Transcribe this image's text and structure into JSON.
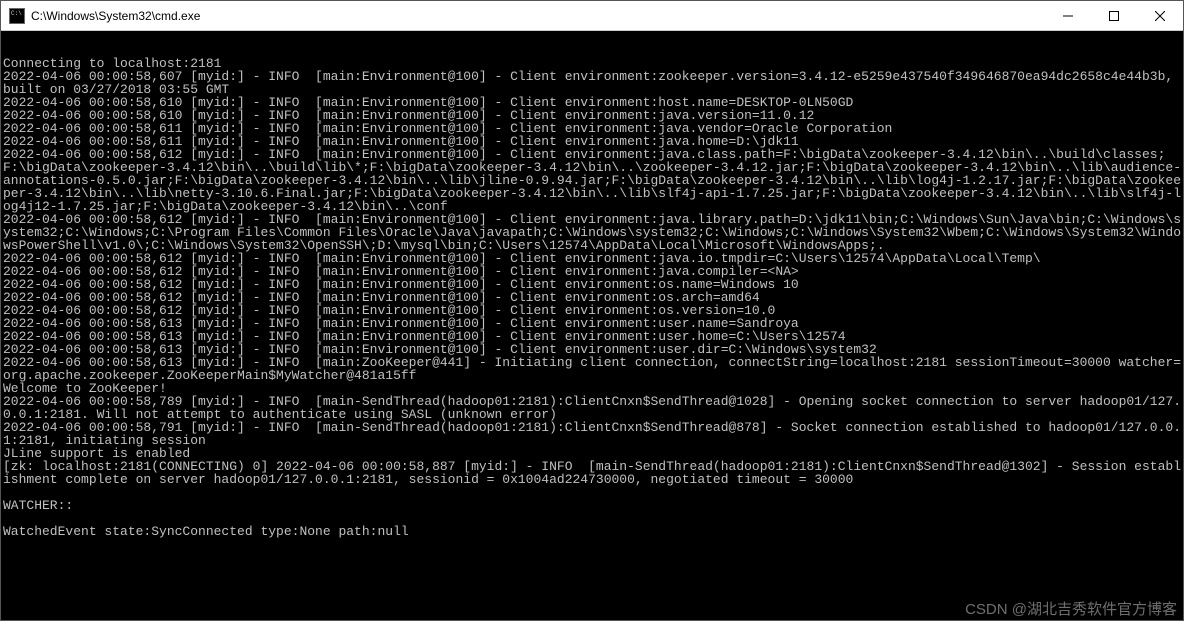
{
  "window": {
    "title": "C:\\Windows\\System32\\cmd.exe"
  },
  "terminal": {
    "lines": [
      "Connecting to localhost:2181",
      "2022-04-06 00:00:58,607 [myid:] - INFO  [main:Environment@100] - Client environment:zookeeper.version=3.4.12-e5259e437540f349646870ea94dc2658c4e44b3b, built on 03/27/2018 03:55 GMT",
      "2022-04-06 00:00:58,610 [myid:] - INFO  [main:Environment@100] - Client environment:host.name=DESKTOP-0LN50GD",
      "2022-04-06 00:00:58,610 [myid:] - INFO  [main:Environment@100] - Client environment:java.version=11.0.12",
      "2022-04-06 00:00:58,611 [myid:] - INFO  [main:Environment@100] - Client environment:java.vendor=Oracle Corporation",
      "2022-04-06 00:00:58,611 [myid:] - INFO  [main:Environment@100] - Client environment:java.home=D:\\jdk11",
      "2022-04-06 00:00:58,612 [myid:] - INFO  [main:Environment@100] - Client environment:java.class.path=F:\\bigData\\zookeeper-3.4.12\\bin\\..\\build\\classes;F:\\bigData\\zookeeper-3.4.12\\bin\\..\\build\\lib\\*;F:\\bigData\\zookeeper-3.4.12\\bin\\..\\zookeeper-3.4.12.jar;F:\\bigData\\zookeeper-3.4.12\\bin\\..\\lib\\audience-annotations-0.5.0.jar;F:\\bigData\\zookeeper-3.4.12\\bin\\..\\lib\\jline-0.9.94.jar;F:\\bigData\\zookeeper-3.4.12\\bin\\..\\lib\\log4j-1.2.17.jar;F:\\bigData\\zookeeper-3.4.12\\bin\\..\\lib\\netty-3.10.6.Final.jar;F:\\bigData\\zookeeper-3.4.12\\bin\\..\\lib\\slf4j-api-1.7.25.jar;F:\\bigData\\zookeeper-3.4.12\\bin\\..\\lib\\slf4j-log4j12-1.7.25.jar;F:\\bigData\\zookeeper-3.4.12\\bin\\..\\conf",
      "2022-04-06 00:00:58,612 [myid:] - INFO  [main:Environment@100] - Client environment:java.library.path=D:\\jdk11\\bin;C:\\Windows\\Sun\\Java\\bin;C:\\Windows\\system32;C:\\Windows;C:\\Program Files\\Common Files\\Oracle\\Java\\javapath;C:\\Windows\\system32;C:\\Windows;C:\\Windows\\System32\\Wbem;C:\\Windows\\System32\\WindowsPowerShell\\v1.0\\;C:\\Windows\\System32\\OpenSSH\\;D:\\mysql\\bin;C:\\Users\\12574\\AppData\\Local\\Microsoft\\WindowsApps;.",
      "2022-04-06 00:00:58,612 [myid:] - INFO  [main:Environment@100] - Client environment:java.io.tmpdir=C:\\Users\\12574\\AppData\\Local\\Temp\\",
      "2022-04-06 00:00:58,612 [myid:] - INFO  [main:Environment@100] - Client environment:java.compiler=<NA>",
      "2022-04-06 00:00:58,612 [myid:] - INFO  [main:Environment@100] - Client environment:os.name=Windows 10",
      "2022-04-06 00:00:58,612 [myid:] - INFO  [main:Environment@100] - Client environment:os.arch=amd64",
      "2022-04-06 00:00:58,612 [myid:] - INFO  [main:Environment@100] - Client environment:os.version=10.0",
      "2022-04-06 00:00:58,613 [myid:] - INFO  [main:Environment@100] - Client environment:user.name=Sandroya",
      "2022-04-06 00:00:58,613 [myid:] - INFO  [main:Environment@100] - Client environment:user.home=C:\\Users\\12574",
      "2022-04-06 00:00:58,613 [myid:] - INFO  [main:Environment@100] - Client environment:user.dir=C:\\Windows\\system32",
      "2022-04-06 00:00:58,613 [myid:] - INFO  [main:ZooKeeper@441] - Initiating client connection, connectString=localhost:2181 sessionTimeout=30000 watcher=org.apache.zookeeper.ZooKeeperMain$MyWatcher@481a15ff",
      "Welcome to ZooKeeper!",
      "2022-04-06 00:00:58,789 [myid:] - INFO  [main-SendThread(hadoop01:2181):ClientCnxn$SendThread@1028] - Opening socket connection to server hadoop01/127.0.0.1:2181. Will not attempt to authenticate using SASL (unknown error)",
      "2022-04-06 00:00:58,791 [myid:] - INFO  [main-SendThread(hadoop01:2181):ClientCnxn$SendThread@878] - Socket connection established to hadoop01/127.0.0.1:2181, initiating session",
      "JLine support is enabled",
      "[zk: localhost:2181(CONNECTING) 0] 2022-04-06 00:00:58,887 [myid:] - INFO  [main-SendThread(hadoop01:2181):ClientCnxn$SendThread@1302] - Session establishment complete on server hadoop01/127.0.0.1:2181, sessionid = 0x1004ad224730000, negotiated timeout = 30000",
      "",
      "WATCHER::",
      "",
      "WatchedEvent state:SyncConnected type:None path:null"
    ]
  },
  "watermark": "CSDN @湖北吉秀软件官方博客"
}
